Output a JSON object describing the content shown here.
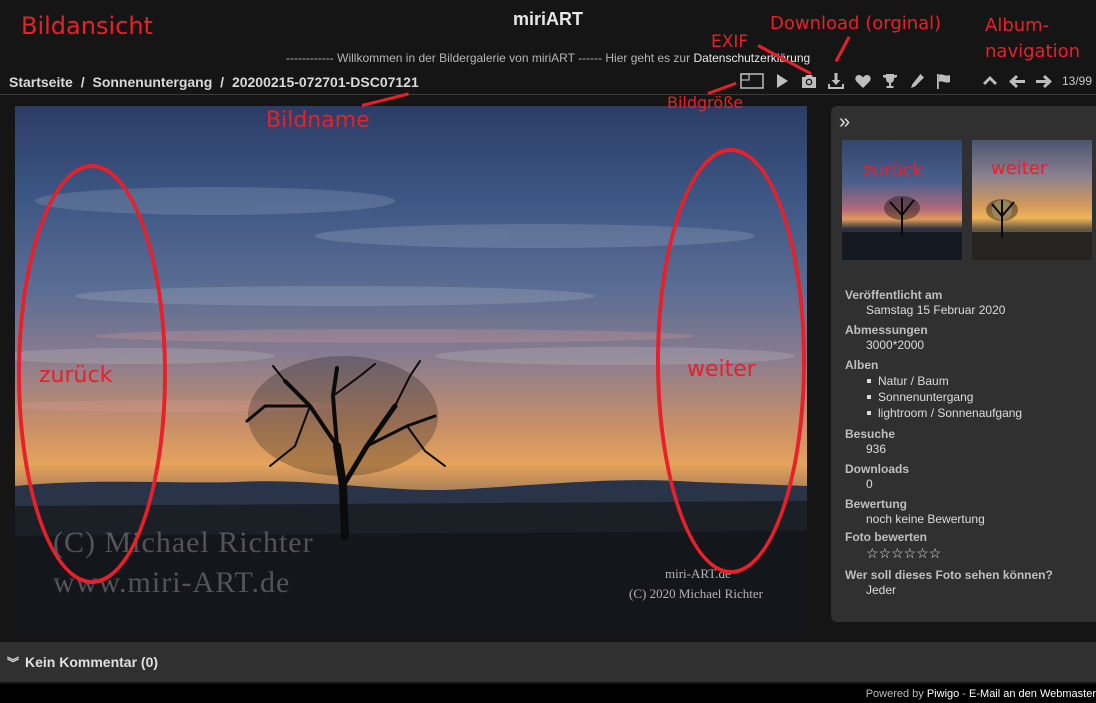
{
  "header": {
    "site_title": "miriART",
    "welcome_text": "------------ Willkommen in der Bildergalerie von miriART ------ Hier geht es zur ",
    "privacy_link": "Datenschutzerklärung"
  },
  "breadcrumb": {
    "home": "Startseite",
    "sep1": "/",
    "album": "Sonnenuntergang",
    "sep2": "/",
    "image": "20200215-072701-DSC07121"
  },
  "toolbar": {
    "icons": [
      "image-size-icon",
      "play-slideshow-icon",
      "camera-exif-icon",
      "download-icon",
      "heart-favorite-icon",
      "trophy-icon",
      "pencil-edit-icon",
      "flag-icon",
      "arrow-up-icon",
      "arrow-left-icon",
      "arrow-right-icon"
    ],
    "counter": "13/99"
  },
  "photo": {
    "watermark_line1": "(C) Michael Richter",
    "watermark_line2": "www.miri-ART.de",
    "signature_line1": "miri-ART.de",
    "signature_line2": "(C) 2020   Michael Richter"
  },
  "panel": {
    "collapse_symbol": "»",
    "details": {
      "published_label": "Veröffentlicht am",
      "published_value": "Samstag 15 Februar 2020",
      "dimensions_label": "Abmessungen",
      "dimensions_value": "3000*2000",
      "albums_label": "Alben",
      "albums": [
        "Natur / Baum",
        "Sonnenuntergang",
        "lightroom / Sonnenaufgang"
      ],
      "visits_label": "Besuche",
      "visits_value": "936",
      "downloads_label": "Downloads",
      "downloads_value": "0",
      "rating_label": "Bewertung",
      "rating_value": "noch keine Bewertung",
      "rate_label": "Foto bewerten",
      "rate_stars": "☆☆☆☆☆☆",
      "privacy_label": "Wer soll dieses Foto sehen können?",
      "privacy_value": "Jeder"
    }
  },
  "comments": {
    "chevron": "︾",
    "label": "Kein Kommentar (0)"
  },
  "footer": {
    "powered_by": "Powered by ",
    "piwigo": "Piwigo",
    "separator": " - ",
    "email": "E-Mail an den Webmaster"
  },
  "annotations": {
    "color": "#e8202a",
    "bildansicht": "Bildansicht",
    "download": "Download (orginal)",
    "album_nav_1": "Album-",
    "album_nav_2": "navigation",
    "exif": "EXIF",
    "bildgroesse": "Bildgröße",
    "bildname": "Bildname",
    "zurueck_photo": "zurück",
    "weiter_photo": "weiter",
    "zurueck_thumb": "zurück",
    "weiter_thumb": "weiter"
  }
}
